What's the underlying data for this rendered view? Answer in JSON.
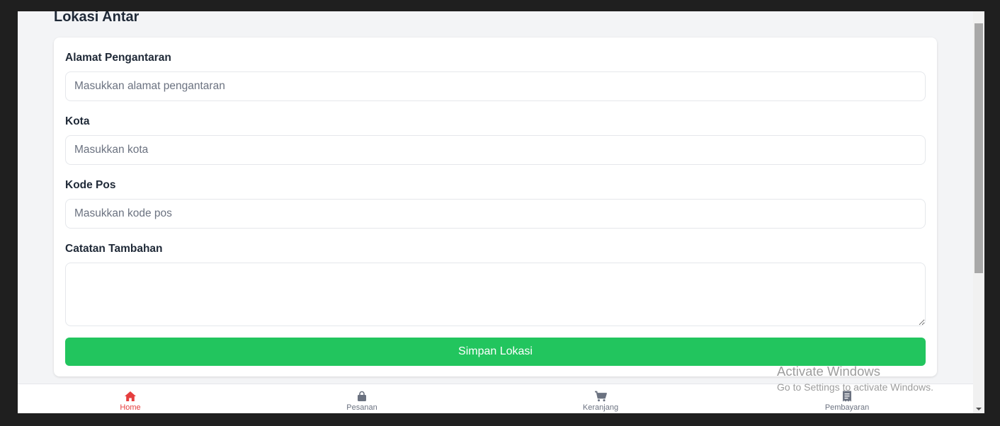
{
  "page": {
    "title": "Lokasi Antar"
  },
  "form": {
    "address": {
      "label": "Alamat Pengantaran",
      "placeholder": "Masukkan alamat pengantaran",
      "value": ""
    },
    "city": {
      "label": "Kota",
      "placeholder": "Masukkan kota",
      "value": ""
    },
    "postal_code": {
      "label": "Kode Pos",
      "placeholder": "Masukkan kode pos",
      "value": ""
    },
    "notes": {
      "label": "Catatan Tambahan",
      "value": ""
    },
    "save_label": "Simpan Lokasi"
  },
  "bottom_nav": {
    "items": [
      {
        "label": "Home",
        "icon": "home-icon",
        "active": true
      },
      {
        "label": "Pesanan",
        "icon": "shopping-bag-icon",
        "active": false
      },
      {
        "label": "Keranjang",
        "icon": "cart-icon",
        "active": false
      },
      {
        "label": "Pembayaran",
        "icon": "receipt-icon",
        "active": false
      }
    ]
  },
  "watermark": {
    "title": "Activate Windows",
    "subtitle": "Go to Settings to activate Windows."
  },
  "colors": {
    "accent": "#22c55e",
    "active_nav": "#e53e3e",
    "inactive_nav": "#6b7280",
    "background": "#f3f4f6"
  }
}
